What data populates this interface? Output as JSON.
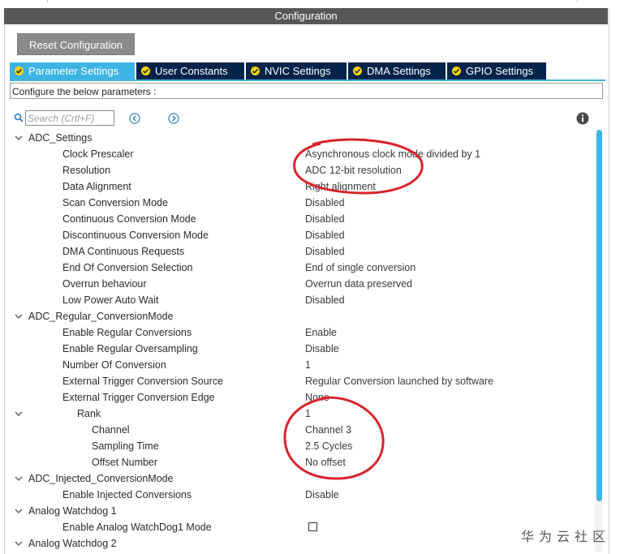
{
  "window": {
    "title": "Configuration"
  },
  "toolbar": {
    "reset_label": "Reset Configuration"
  },
  "tabs": [
    {
      "label": "Parameter Settings",
      "active": true
    },
    {
      "label": "User Constants",
      "active": false
    },
    {
      "label": "NVIC Settings",
      "active": false
    },
    {
      "label": "DMA Settings",
      "active": false
    },
    {
      "label": "GPIO Settings",
      "active": false
    }
  ],
  "configure_text": "Configure the below parameters :",
  "search": {
    "placeholder": "Search (Crtl+F)",
    "value": ""
  },
  "params": {
    "adc_settings": {
      "label": "ADC_Settings",
      "items": [
        {
          "label": "Clock Prescaler",
          "value": "Asynchronous clock mode divided by 1"
        },
        {
          "label": "Resolution",
          "value": "ADC 12-bit resolution"
        },
        {
          "label": "Data Alignment",
          "value": "Right alignment"
        },
        {
          "label": "Scan Conversion Mode",
          "value": "Disabled"
        },
        {
          "label": "Continuous Conversion Mode",
          "value": "Disabled"
        },
        {
          "label": "Discontinuous Conversion Mode",
          "value": "Disabled"
        },
        {
          "label": "DMA Continuous Requests",
          "value": "Disabled"
        },
        {
          "label": "End Of Conversion Selection",
          "value": "End of single conversion"
        },
        {
          "label": "Overrun behaviour",
          "value": "Overrun data preserved"
        },
        {
          "label": "Low Power Auto Wait",
          "value": "Disabled"
        }
      ]
    },
    "adc_regular": {
      "label": "ADC_Regular_ConversionMode",
      "items": [
        {
          "label": "Enable Regular Conversions",
          "value": "Enable"
        },
        {
          "label": "Enable Regular Oversampling",
          "value": "Disable"
        },
        {
          "label": "Number Of Conversion",
          "value": "1"
        },
        {
          "label": "External Trigger Conversion Source",
          "value": "Regular Conversion launched by software"
        },
        {
          "label": "External Trigger Conversion Edge",
          "value": "None"
        }
      ],
      "rank": {
        "label": "Rank",
        "value": "1",
        "items": [
          {
            "label": "Channel",
            "value": "Channel 3"
          },
          {
            "label": "Sampling Time",
            "value": "2.5 Cycles"
          },
          {
            "label": "Offset Number",
            "value": "No offset"
          }
        ]
      }
    },
    "adc_injected": {
      "label": "ADC_Injected_ConversionMode",
      "items": [
        {
          "label": "Enable Injected Conversions",
          "value": "Disable"
        }
      ]
    },
    "watchdog1": {
      "label": "Analog Watchdog 1",
      "items": [
        {
          "label": "Enable Analog WatchDog1 Mode",
          "checked": false
        }
      ]
    },
    "watchdog2": {
      "label": "Analog Watchdog 2"
    }
  },
  "watermark": "华为云社区",
  "colors": {
    "tab_active": "#3cb4e6",
    "tab_inactive": "#03234b",
    "tab_check": "#ffd200",
    "title_bar": "#575757",
    "annotation": "#d8232a"
  }
}
